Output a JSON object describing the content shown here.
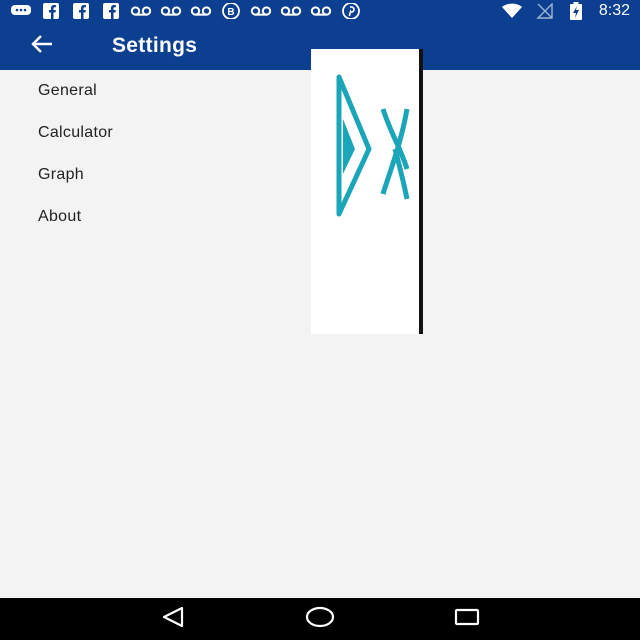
{
  "status_bar": {
    "time": "8:32",
    "notification_icons": [
      "message-icon",
      "facebook-icon",
      "facebook-icon",
      "facebook-icon",
      "voicemail-icon",
      "voicemail-icon",
      "voicemail-icon",
      "blogger-icon",
      "voicemail-icon",
      "voicemail-icon",
      "voicemail-icon",
      "pinterest-icon"
    ],
    "system_icons": [
      "wifi-icon",
      "no-signal-icon",
      "battery-charging-icon"
    ]
  },
  "app_bar": {
    "title": "Settings",
    "back_icon": "arrow-left-icon"
  },
  "settings": {
    "items": [
      {
        "label": "General"
      },
      {
        "label": "Calculator"
      },
      {
        "label": "Graph"
      },
      {
        "label": "About"
      }
    ]
  },
  "logo": {
    "icon": "dx-logo",
    "color": "#1aa6b8"
  },
  "nav_bar": {
    "buttons": [
      "back-triangle-icon",
      "home-circle-icon",
      "recents-square-icon"
    ]
  },
  "colors": {
    "primary": "#0d3f91",
    "background": "#f3f3f3",
    "text": "#222222",
    "accent": "#1aa6b8"
  }
}
